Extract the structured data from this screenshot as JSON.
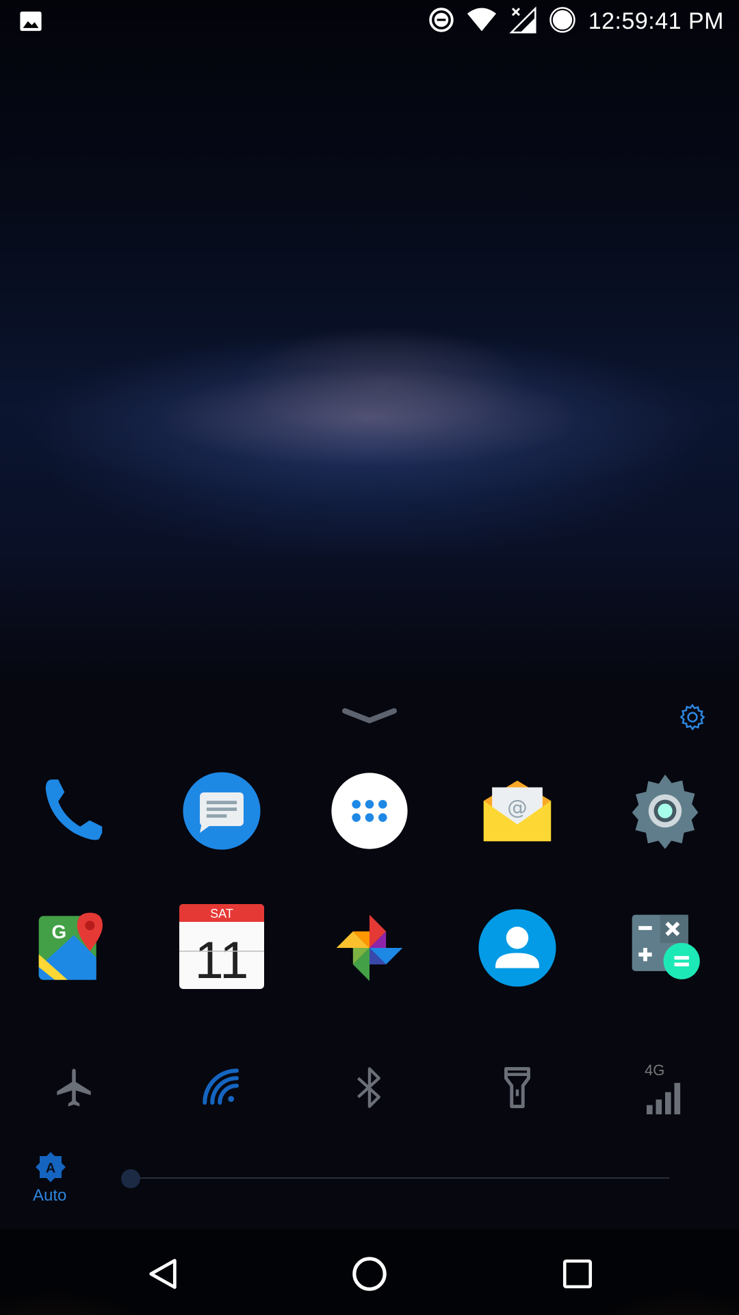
{
  "status_bar": {
    "time": "12:59:41 PM",
    "icons": [
      "gallery-notification-icon",
      "do-not-disturb-icon",
      "wifi-icon",
      "no-signal-icon",
      "battery-icon"
    ]
  },
  "dock_row1": [
    {
      "name": "Phone",
      "icon": "phone-icon",
      "color": "#1e88e5"
    },
    {
      "name": "Messages",
      "icon": "messages-icon",
      "color": "#1e88e5"
    },
    {
      "name": "All apps",
      "icon": "app-drawer-icon",
      "color": "#ffffff"
    },
    {
      "name": "Email",
      "icon": "email-icon",
      "color": "#fbc02d"
    },
    {
      "name": "Settings",
      "icon": "settings-gear-icon",
      "color": "#607d8b"
    }
  ],
  "dock_row2": [
    {
      "name": "Maps",
      "icon": "maps-icon"
    },
    {
      "name": "Calendar",
      "icon": "calendar-icon",
      "day": "SAT",
      "date": "11"
    },
    {
      "name": "Photos",
      "icon": "photos-pinwheel-icon"
    },
    {
      "name": "Contacts",
      "icon": "contacts-icon",
      "color": "#1e88e5"
    },
    {
      "name": "Calculator",
      "icon": "calculator-icon"
    }
  ],
  "calendar": {
    "day": "SAT",
    "date": "11"
  },
  "quick_settings": {
    "toggles": [
      "airplane-mode-icon",
      "wifi-hotspot-icon",
      "bluetooth-icon",
      "flashlight-icon",
      "mobile-data-icon"
    ],
    "network_type": "4G"
  },
  "brightness": {
    "mode_label": "Auto",
    "level": 0.0
  },
  "colors": {
    "accent": "#2e86de",
    "inactive": "#777777"
  }
}
